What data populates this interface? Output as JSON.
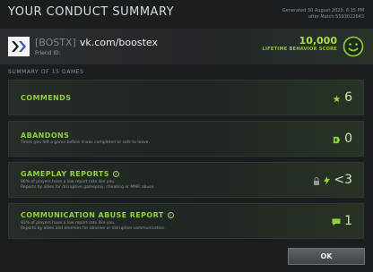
{
  "header": {
    "title": "YOUR CONDUCT SUMMARY",
    "generated": "Generated 30 August 2020, 6:15 PM",
    "after_match": "after Match 5593022643"
  },
  "profile": {
    "tag": "[BOSTX]",
    "name": "vk.com/boostex",
    "friend_id": "Friend ID:"
  },
  "score": {
    "value": "10,000",
    "label": "LIFETIME BEHAVIOR SCORE"
  },
  "summary_label": "SUMMARY OF 15 GAMES",
  "panels": [
    {
      "title": "COMMENDS",
      "desc1": "",
      "desc2": "",
      "value": "6",
      "icon": "star-icon"
    },
    {
      "title": "ABANDONS",
      "desc1": "Times you left a game before it was completed or safe to leave.",
      "desc2": "",
      "value": "0",
      "icon": "abandon-icon"
    },
    {
      "title": "GAMEPLAY REPORTS",
      "desc1": "86% of players have a low report rate like you.",
      "desc2": "Reports by allies for disruptive gameplay, cheating or MMR abuse.",
      "value": "<3",
      "icon": "lock-bolt-icon"
    },
    {
      "title": "COMMUNICATION ABUSE REPORT",
      "desc1": "83% of players have a low report rate like you.",
      "desc2": "Reports by allies and enemies for abusive or disruptive communication.",
      "value": "1",
      "icon": "chat-icon"
    }
  ],
  "ok_label": "OK",
  "colors": {
    "accent_green": "#8fd13f",
    "background": "#1b1e20"
  }
}
